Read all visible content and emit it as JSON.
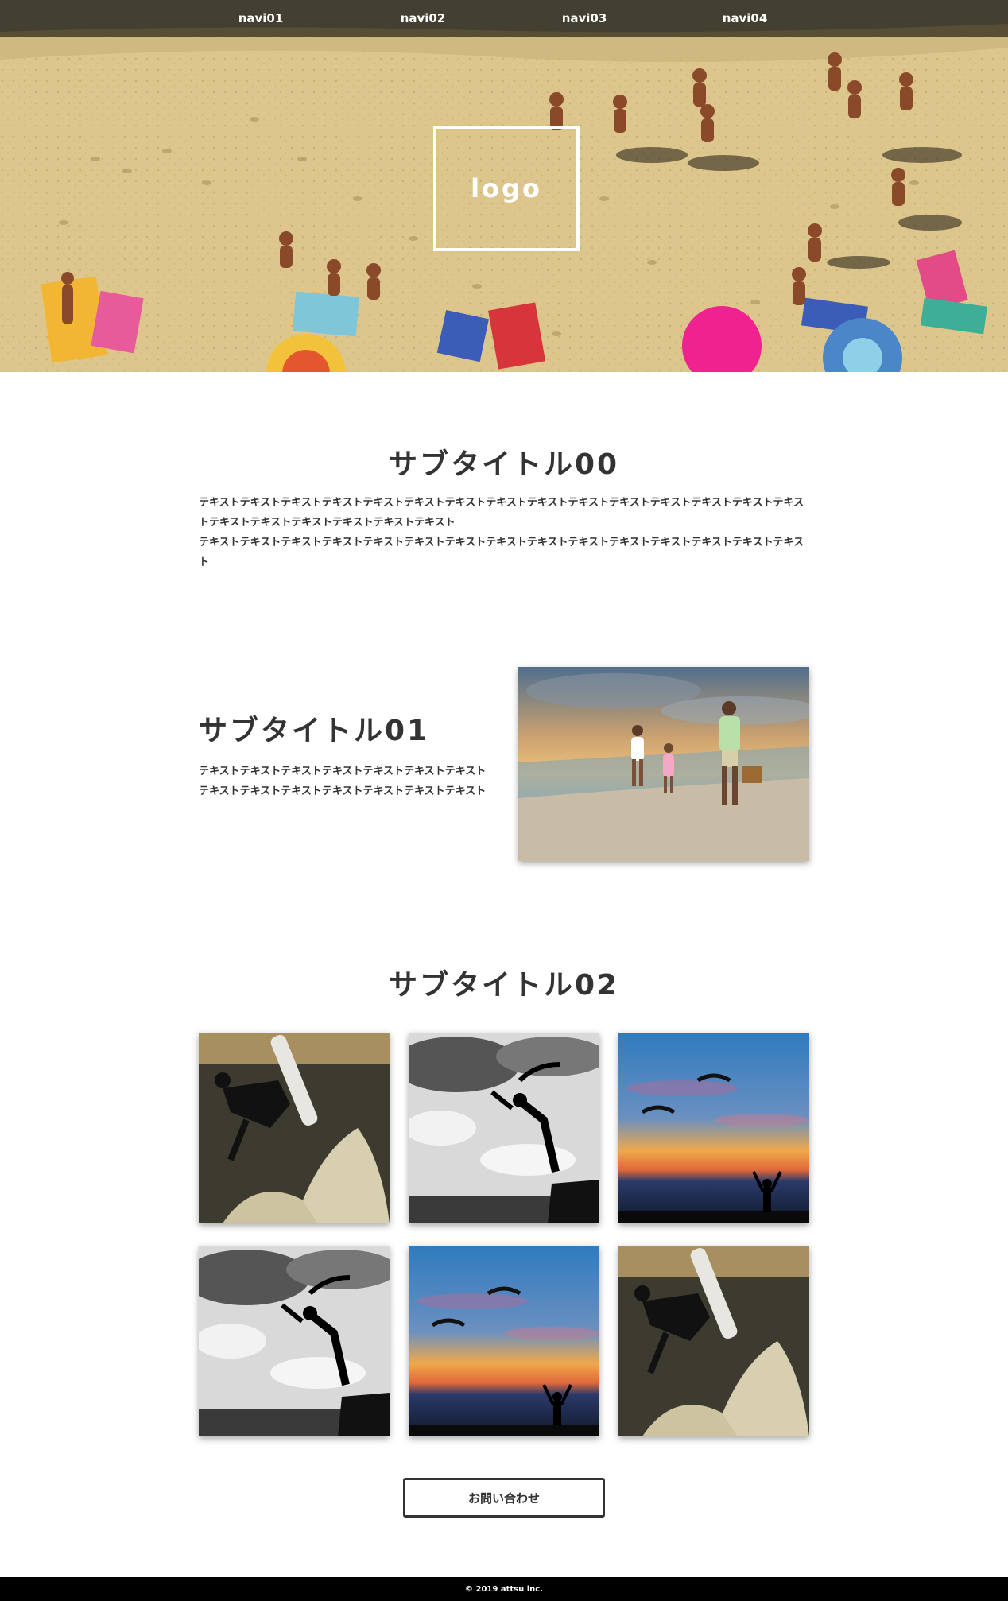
{
  "nav": {
    "items": [
      {
        "label": "navi01"
      },
      {
        "label": "navi02"
      },
      {
        "label": "navi03"
      },
      {
        "label": "navi04"
      }
    ]
  },
  "hero": {
    "logo": "logo"
  },
  "section00": {
    "title": "サブタイトル00",
    "text1": "テキストテキストテキストテキストテキストテキストテキストテキストテキストテキストテキストテキストテキストテキストテキストテキストテキストテキストテキストテキストテキスト",
    "text2": "テキストテキストテキストテキストテキストテキストテキストテキストテキストテキストテキストテキストテキストテキストテキスト"
  },
  "section01": {
    "title": "サブタイトル01",
    "text": "テキストテキストテキストテキストテキストテキストテキストテキストテキストテキストテキストテキストテキストテキスト"
  },
  "section02": {
    "title": "サブタイトル02"
  },
  "contact": {
    "label": "お問い合わせ"
  },
  "footer": {
    "copyright": "© 2019 attsu inc."
  }
}
